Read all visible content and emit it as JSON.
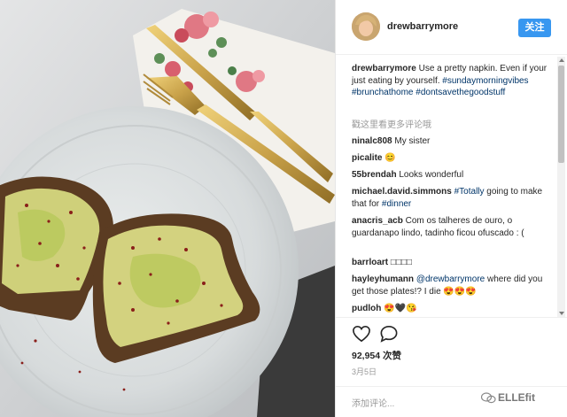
{
  "post": {
    "username": "drewbarrymore",
    "follow_label": "关注",
    "caption": {
      "username": "drewbarrymore",
      "text": "Use a pretty napkin. Even if your just eating by yourself.",
      "hashtags": [
        "#sundaymorningvibes",
        "#brunchathome",
        "#dontsavethegoodstuff"
      ]
    },
    "load_more": "戳这里看更多评论哦",
    "comments": [
      {
        "user": "ninalc808",
        "text": "My sister"
      },
      {
        "user": "picalite",
        "text": "😊"
      },
      {
        "user": "55brendah",
        "text": "Looks wonderful"
      },
      {
        "user": "michael.david.simmons",
        "pre": "",
        "tag1": "#Totally",
        "mid": " going to make that for ",
        "tag2": "#dinner"
      },
      {
        "user": "anacris_acb",
        "text": "Com os talheres de ouro, o guardanapo lindo, tadinho ficou ofuscado : ("
      },
      {
        "user": "barrloart",
        "text": "□□□□"
      },
      {
        "user": "hayleyhumann",
        "tag1": "@drewbarrymore",
        "text": " where did you get those plates!? I die 😍😍😍"
      },
      {
        "user": "pudloh",
        "text": "😍🖤😘"
      }
    ],
    "likes": "92,954 次赞",
    "date": "3月5日",
    "add_comment_placeholder": "添加评论...",
    "watermark": "ELLEfit"
  },
  "colors": {
    "follow_button": "#3897f0",
    "hashtag": "#003569",
    "gold_cutlery": "#c9a24a"
  },
  "icons": [
    "heart-icon",
    "comment-icon",
    "wechat-watermark-icon"
  ]
}
